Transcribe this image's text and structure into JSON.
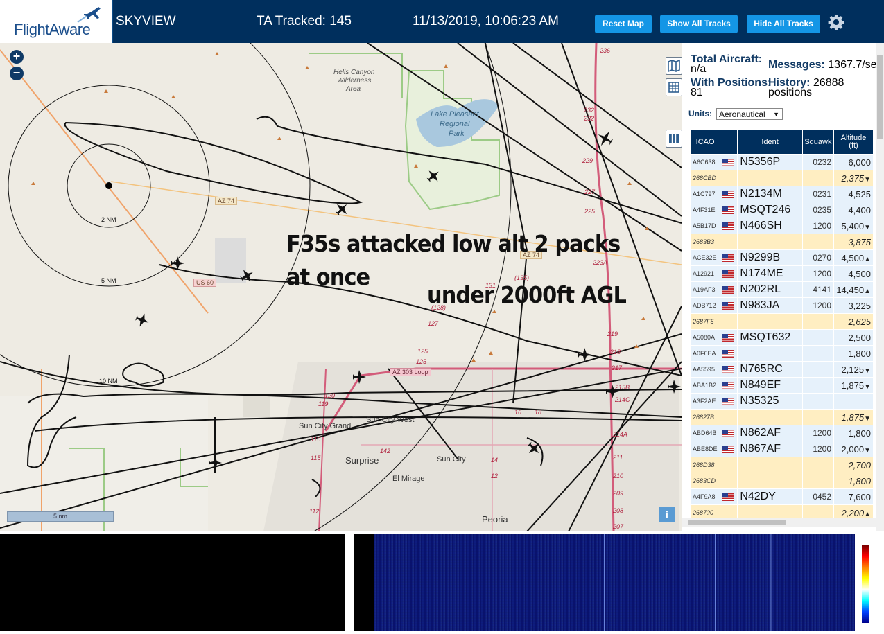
{
  "header": {
    "logo_text": "FlightAware",
    "app_name": "SKYVIEW",
    "ta_tracked": "TA Tracked: 145",
    "datetime": "11/13/2019, 10:06:23 AM",
    "buttons": {
      "reset_map": "Reset Map",
      "show_all": "Show All Tracks",
      "hide_all": "Hide All Tracks"
    }
  },
  "map": {
    "overlay_line1": "F35s attacked low alt 2 packs",
    "overlay_line2": "at once",
    "overlay_line3": "under 2000ft AGL",
    "scale_label": "5 nm",
    "zoom_in": "+",
    "zoom_out": "−",
    "info": "i",
    "labels": {
      "hells": "Hells Canyon",
      "wild": "Wilderness",
      "area": "Area",
      "lake1": "Lake Pleasant",
      "lake2": "Regional",
      "lake3": "Park",
      "az74": "AZ 74",
      "az74b": "AZ 74",
      "us60": "US 60",
      "az303": "AZ 303 Loop",
      "suncitygrand": "Sun City Grand",
      "suncitywest": "Sun City West",
      "suncity": "Sun City",
      "surprise": "Surprise",
      "elmirage": "El Mirage",
      "peoria": "Peoria",
      "nm2": "2 NM",
      "nm5": "5 NM",
      "nm10": "10 NM",
      "r236": "236",
      "r232a": "232",
      "r232b": "232",
      "r229": "229",
      "r227": "227",
      "r225": "225",
      "r223a": "223A",
      "r219": "219",
      "r218": "218",
      "r217": "217",
      "r215b": "215B",
      "r214c": "214C",
      "r214a": "214A",
      "r211": "211",
      "r210": "210",
      "r209": "209",
      "r208": "208",
      "r207": "207",
      "r131": "131",
      "r135": "(135)",
      "r128": "(128)",
      "r127": "127",
      "r125a": "125",
      "r125b": "125",
      "r120": "120",
      "r119": "119",
      "r116": "116",
      "r115": "115",
      "r112": "112",
      "r142": "142",
      "r16": "16",
      "r18": "18",
      "r14": "14",
      "r12": "12"
    }
  },
  "sidebar": {
    "total_aircraft_label": "Total Aircraft:",
    "total_aircraft_value": "n/a",
    "with_positions_label": "With Positions:",
    "with_positions_value": "81",
    "messages_label": "Messages:",
    "messages_value": "1367.7/sec",
    "history_label": "History:",
    "history_value": "26888",
    "history_unit": "positions",
    "units_label": "Units:",
    "units_value": "Aeronautical",
    "columns": {
      "icao": "ICAO",
      "ident": "Ident",
      "squawk": "Squawk",
      "altitude": "Altitude",
      "altitude_unit": "(ft)"
    },
    "rows": [
      {
        "icao": "A6C638",
        "flag": true,
        "ident": "N5356P",
        "squawk": "0232",
        "alt": "6,000",
        "trend": "",
        "pending": false
      },
      {
        "icao": "268CBD",
        "flag": false,
        "ident": "",
        "squawk": "",
        "alt": "2,375",
        "trend": "▼",
        "pending": true
      },
      {
        "icao": "A1C797",
        "flag": true,
        "ident": "N2134M",
        "squawk": "0231",
        "alt": "4,525",
        "trend": "",
        "pending": false
      },
      {
        "icao": "A4F31E",
        "flag": true,
        "ident": "MSQT246",
        "squawk": "0235",
        "alt": "4,400",
        "trend": "",
        "pending": false
      },
      {
        "icao": "A5B17D",
        "flag": true,
        "ident": "N466SH",
        "squawk": "1200",
        "alt": "5,400",
        "trend": "▼",
        "pending": false
      },
      {
        "icao": "2683B3",
        "flag": false,
        "ident": "",
        "squawk": "",
        "alt": "3,875",
        "trend": "",
        "pending": true
      },
      {
        "icao": "ACE32E",
        "flag": true,
        "ident": "N9299B",
        "squawk": "0270",
        "alt": "4,500",
        "trend": "▲",
        "pending": false
      },
      {
        "icao": "A12921",
        "flag": true,
        "ident": "N174ME",
        "squawk": "1200",
        "alt": "4,500",
        "trend": "",
        "pending": false
      },
      {
        "icao": "A19AF3",
        "flag": true,
        "ident": "N202RL",
        "squawk": "4141",
        "alt": "14,450",
        "trend": "▲",
        "pending": false
      },
      {
        "icao": "ADB712",
        "flag": true,
        "ident": "N983JA",
        "squawk": "1200",
        "alt": "3,225",
        "trend": "",
        "pending": false
      },
      {
        "icao": "2687F5",
        "flag": false,
        "ident": "",
        "squawk": "",
        "alt": "2,625",
        "trend": "",
        "pending": true
      },
      {
        "icao": "A5080A",
        "flag": true,
        "ident": "MSQT632",
        "squawk": "",
        "alt": "2,500",
        "trend": "",
        "pending": false
      },
      {
        "icao": "A0F6EA",
        "flag": true,
        "ident": "",
        "squawk": "",
        "alt": "1,800",
        "trend": "",
        "pending": false
      },
      {
        "icao": "AA5595",
        "flag": true,
        "ident": "N765RC",
        "squawk": "",
        "alt": "2,125",
        "trend": "▼",
        "pending": false
      },
      {
        "icao": "ABA1B2",
        "flag": true,
        "ident": "N849EF",
        "squawk": "",
        "alt": "1,875",
        "trend": "▼",
        "pending": false
      },
      {
        "icao": "A3F2AE",
        "flag": true,
        "ident": "N35325",
        "squawk": "",
        "alt": "",
        "trend": "",
        "pending": false
      },
      {
        "icao": "26827B",
        "flag": false,
        "ident": "",
        "squawk": "",
        "alt": "1,875",
        "trend": "▼",
        "pending": true
      },
      {
        "icao": "ABD64B",
        "flag": true,
        "ident": "N862AF",
        "squawk": "1200",
        "alt": "1,800",
        "trend": "",
        "pending": false
      },
      {
        "icao": "ABE8DE",
        "flag": true,
        "ident": "N867AF",
        "squawk": "1200",
        "alt": "2,000",
        "trend": "▼",
        "pending": false
      },
      {
        "icao": "268D38",
        "flag": false,
        "ident": "",
        "squawk": "",
        "alt": "2,700",
        "trend": "",
        "pending": true
      },
      {
        "icao": "2683CD",
        "flag": false,
        "ident": "",
        "squawk": "",
        "alt": "1,800",
        "trend": "",
        "pending": true
      },
      {
        "icao": "A4F9A8",
        "flag": true,
        "ident": "N42DY",
        "squawk": "0452",
        "alt": "7,600",
        "trend": "",
        "pending": false
      },
      {
        "icao": "2687?0",
        "flag": false,
        "ident": "",
        "squawk": "",
        "alt": "2,200",
        "trend": "▲",
        "pending": true
      }
    ]
  },
  "colors": {
    "header_bg": "#002f5d",
    "button": "#1496e6",
    "row": "#e6f1fb",
    "row_pending": "#ffeec2"
  },
  "icons": [
    "airplane-logo-icon",
    "gear-icon",
    "map-layer-icon",
    "grid-icon",
    "columns-icon",
    "zoom-in-icon",
    "zoom-out-icon",
    "info-icon"
  ]
}
